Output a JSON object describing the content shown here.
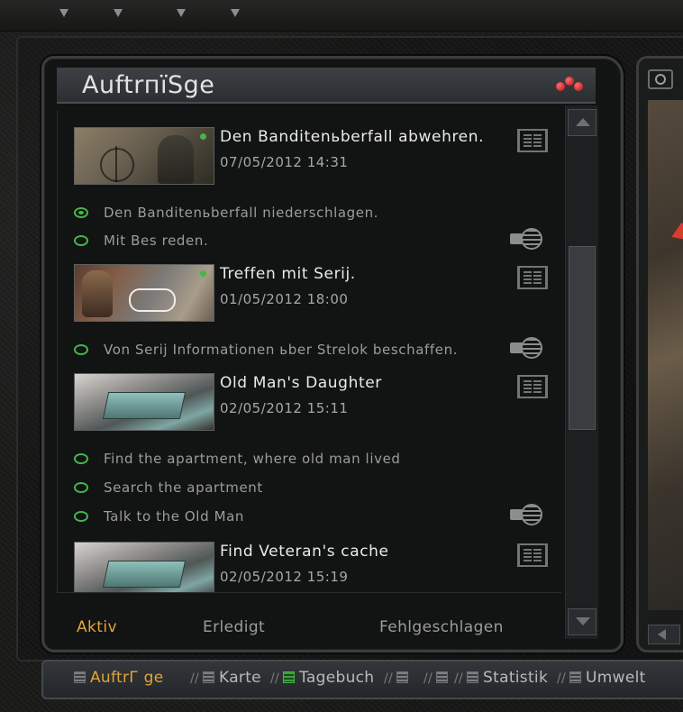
{
  "window": {
    "title": "AuftrпїSge"
  },
  "quests": [
    {
      "title": "Den Banditenьberfall abwehren.",
      "date": "07/05/2012 14:31",
      "thumb_style": "t1",
      "tasks": [
        {
          "label": "Den Banditenьberfall niederschlagen.",
          "active": true,
          "map_icon": false
        },
        {
          "label": "Mit Bes reden.",
          "active": false,
          "map_icon": true
        }
      ]
    },
    {
      "title": "Treffen mit Serij.",
      "date": "01/05/2012 18:00",
      "thumb_style": "t2",
      "tasks": [
        {
          "label": "Von Serij Informationen ьber Strelok beschaffen.",
          "active": false,
          "map_icon": true
        }
      ]
    },
    {
      "title": "Old Man's Daughter",
      "date": "02/05/2012 15:11",
      "thumb_style": "t3",
      "tasks": [
        {
          "label": "Find the apartment, where old man lived",
          "active": false,
          "map_icon": false
        },
        {
          "label": "Search the apartment",
          "active": false,
          "map_icon": false
        },
        {
          "label": "Talk to the Old Man",
          "active": false,
          "map_icon": true
        }
      ]
    },
    {
      "title": "Find Veteran's cache",
      "date": "02/05/2012 15:19",
      "thumb_style": "t3",
      "tasks": []
    }
  ],
  "tabs": [
    {
      "label": "Aktiv",
      "active": true
    },
    {
      "label": "Erledigt",
      "active": false
    },
    {
      "label": "Fehlgeschlagen",
      "active": false
    }
  ],
  "bottom_bar": [
    {
      "label": "AuftrГ ge",
      "active": true,
      "icon": "pda-icon",
      "green": false
    },
    {
      "label": "Karte",
      "active": false,
      "icon": "pda-icon",
      "green": false
    },
    {
      "label": "Tagebuch",
      "active": false,
      "icon": "pda-icon",
      "green": true
    },
    {
      "label": "",
      "active": false,
      "icon": "pda-icon",
      "green": false
    },
    {
      "label": "",
      "active": false,
      "icon": "pda-icon",
      "green": false
    },
    {
      "label": "Statistik",
      "active": false,
      "icon": "pda-icon",
      "green": false
    },
    {
      "label": "Umwelt",
      "active": false,
      "icon": "pda-icon",
      "green": false
    }
  ],
  "colors": {
    "accent": "#e0a53a",
    "task_green": "#46b648",
    "panel_bg": "#121313"
  },
  "icons": {
    "header": "red-dots-icon",
    "doc": "journal-icon",
    "map": "map-locate-icon"
  }
}
